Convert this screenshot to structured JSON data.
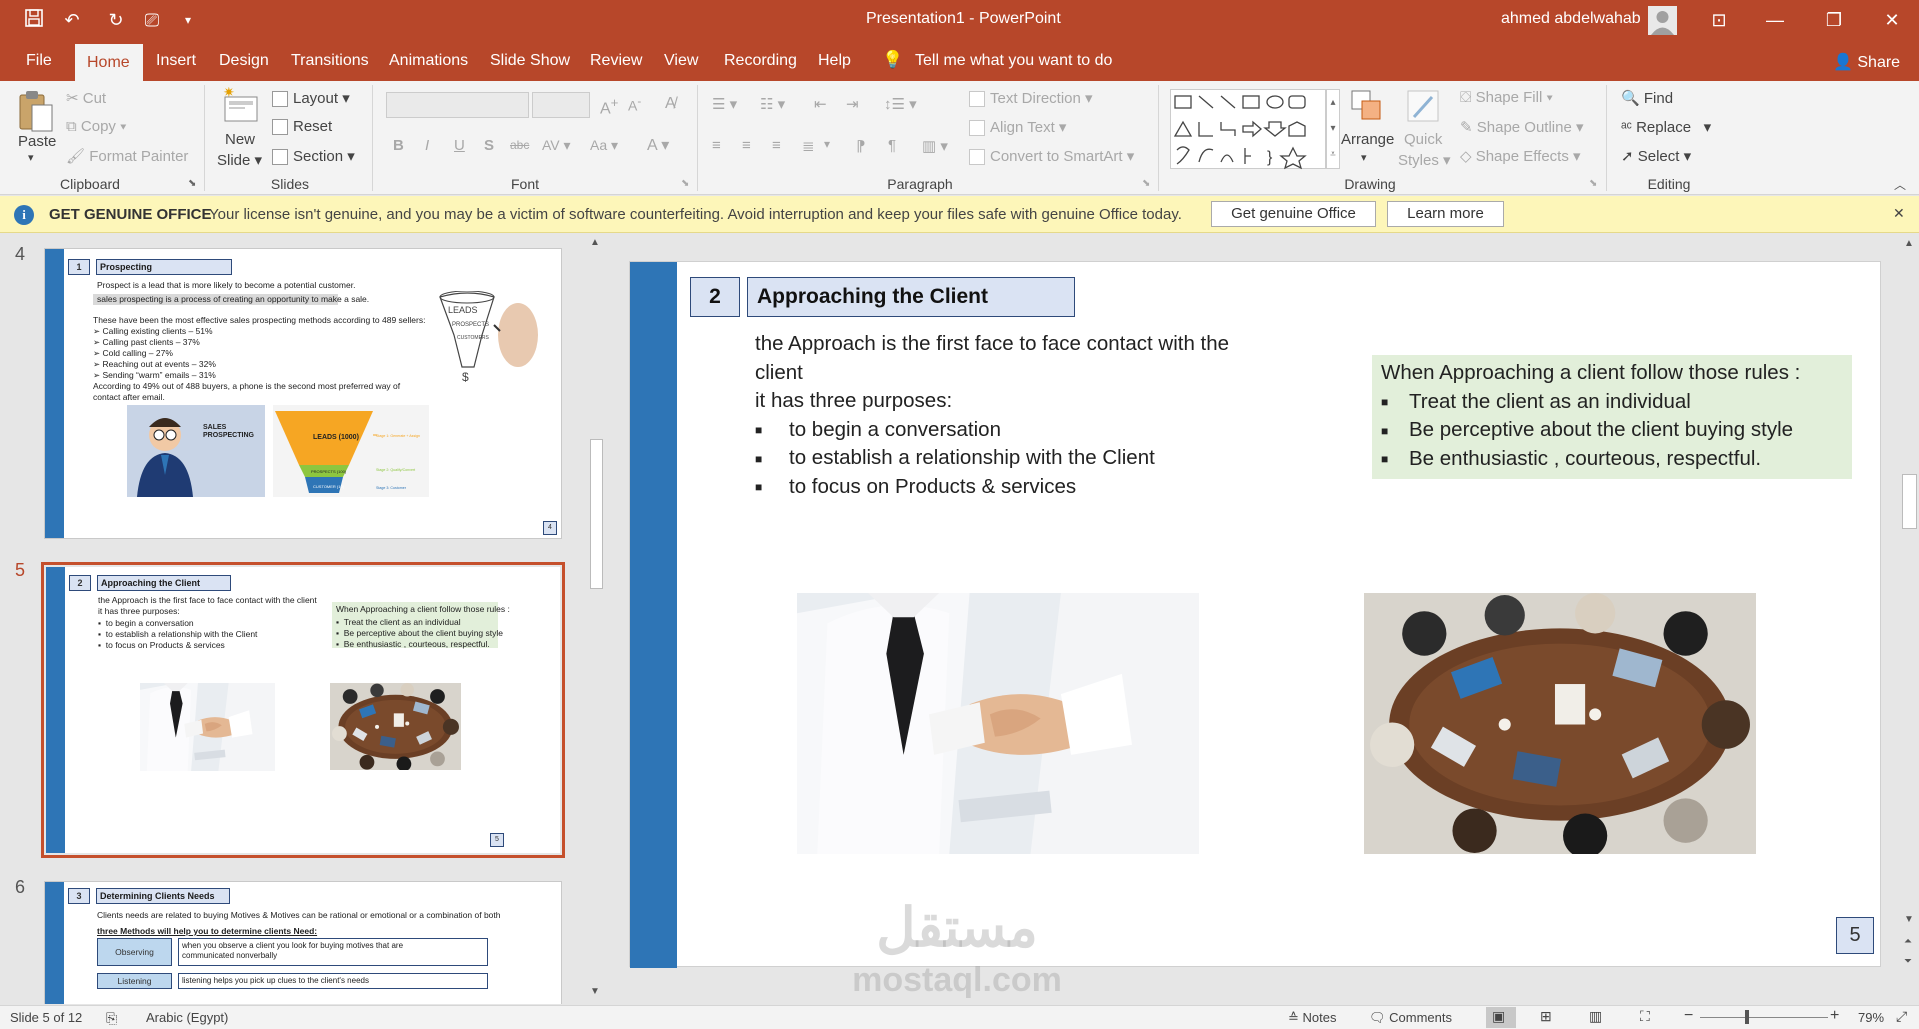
{
  "titlebar": {
    "title": "Presentation1  -  PowerPoint",
    "user": "ahmed abdelwahab"
  },
  "menu": {
    "tabs": [
      "File",
      "Home",
      "Insert",
      "Design",
      "Transitions",
      "Animations",
      "Slide Show",
      "Review",
      "View",
      "Recording",
      "Help"
    ],
    "active": "Home",
    "tell_me": "Tell me what you want to do",
    "share": "Share"
  },
  "ribbon": {
    "clipboard": {
      "paste": "Paste",
      "cut": "Cut",
      "copy": "Copy",
      "format_painter": "Format Painter",
      "label": "Clipboard"
    },
    "slides": {
      "new_slide_1": "New",
      "new_slide_2": "Slide",
      "layout": "Layout",
      "reset": "Reset",
      "section": "Section",
      "label": "Slides"
    },
    "font": {
      "label": "Font"
    },
    "paragraph": {
      "text_direction": "Text Direction",
      "align_text": "Align Text",
      "convert_smartart": "Convert to SmartArt",
      "label": "Paragraph"
    },
    "drawing": {
      "arrange": "Arrange",
      "quick_styles_1": "Quick",
      "quick_styles_2": "Styles",
      "shape_fill": "Shape Fill",
      "shape_outline": "Shape Outline",
      "shape_effects": "Shape Effects",
      "label": "Drawing"
    },
    "editing": {
      "find": "Find",
      "replace": "Replace",
      "select": "Select",
      "label": "Editing"
    }
  },
  "message_bar": {
    "title": "GET GENUINE OFFICE",
    "text": "Your license isn't genuine, and you may be a victim of software counterfeiting. Avoid interruption and keep your files safe with genuine Office today.",
    "button_get": "Get genuine Office",
    "button_learn": "Learn more"
  },
  "thumbnails": {
    "numbers": [
      "4",
      "5",
      "6"
    ],
    "slide4": {
      "num": "1",
      "title": "Prospecting",
      "lines": [
        "Prospect is a lead that is more likely to become a potential customer.",
        "sales prospecting is a process of creating an opportunity to make a sale.",
        "These have been the most effective sales prospecting methods according to 489 sellers:",
        "➢  Calling existing clients – 51%",
        "➢  Calling past clients – 37%",
        "➢  Cold calling – 27%",
        "➢  Reaching out at events – 32%",
        "➢  Sending “warm” emails – 31%",
        "According to 49% out of 488 buyers, a phone is the second most preferred way of",
        "contact after email."
      ],
      "funnel_leads": "LEADS",
      "funnel_prospects": "PROSPECTS",
      "funnel_customers": "CUSTOMERS",
      "sales_prospecting": "SALES PROSPECTING",
      "leads_count": "LEADS (1000)",
      "prospects_count": "PROSPECTS (100)",
      "customer_count": "CUSTOMER (10)",
      "stage1": "Stage 1: Generate + Assign",
      "stage2": "Stage 2: Qualify/Convert",
      "stage3": "Stage 3: Customer",
      "page": "4"
    },
    "slide6": {
      "num": "3",
      "title": "Determining Clients Needs",
      "line1": "Clients needs are related to buying Motives & Motives can be rational or emotional or a combination of  both",
      "line2": "three Methods will help you to determine clients Need:",
      "observing": "Observing",
      "observing_text_1": "when you observe a client you look for buying motives that are",
      "observing_text_2": "communicated nonverbally",
      "listening": "Listening",
      "listening_text": "listening helps you pick up clues to the client's needs"
    }
  },
  "slide": {
    "number_box": "2",
    "title": "Approaching the Client",
    "intro_1": "the Approach is the first face to face contact with the client",
    "intro_2": "it has three purposes:",
    "purposes": [
      "to begin a conversation",
      "to establish a relationship with the Client",
      "to focus on Products & services"
    ],
    "rules_title": "When Approaching a client follow those rules :",
    "rules": [
      "Treat the client as an individual",
      "Be perceptive about the client buying style",
      "Be enthusiastic , courteous, respectful."
    ],
    "page": "5"
  },
  "watermark": {
    "arabic": "مستقل",
    "latin": "mostaql.com"
  },
  "statusbar": {
    "slide": "Slide 5 of 12",
    "language": "Arabic (Egypt)",
    "notes": "Notes",
    "comments": "Comments",
    "zoom": "79%"
  },
  "colors": {
    "accent": "#b7472a",
    "slide_band": "#2e75b6",
    "title_box": "#dae3f3",
    "rules_box": "#e2efda",
    "message_bar": "#fdf6b9"
  }
}
